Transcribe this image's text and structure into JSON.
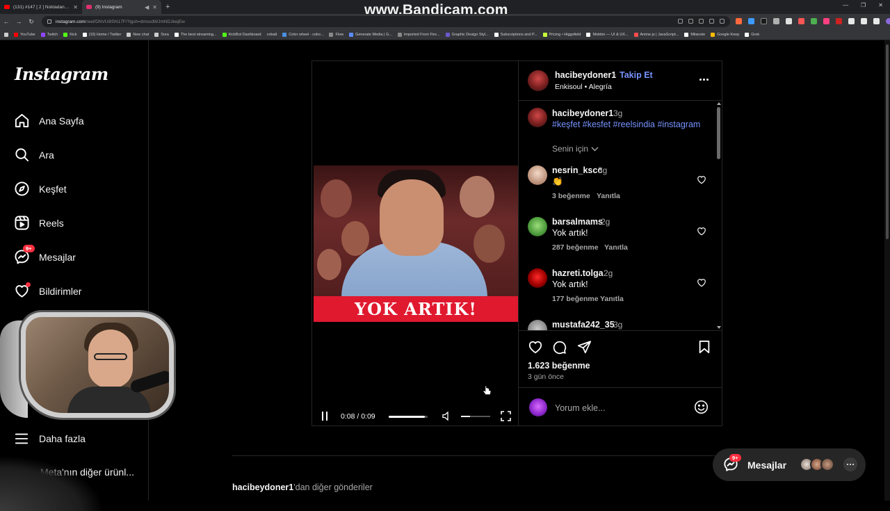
{
  "recording": {
    "watermark": "www.Bandicam.com"
  },
  "browser": {
    "tabs": [
      {
        "label": "(131) #147 [ 2 ] Noktadan Nokt",
        "fav_color": "#ff0000",
        "active": false
      },
      {
        "label": "(9) Instagram",
        "fav_color": "#e1306c",
        "active": true
      }
    ],
    "url": {
      "host": "instagram.com",
      "path": "/reel/DNVUi9SN17F/?igsh=dmsxdWJmNDJkejEw"
    },
    "bookmarks": [
      {
        "label": "YouTube",
        "color": "#ff0000"
      },
      {
        "label": "Twitch",
        "color": "#9146ff"
      },
      {
        "label": "Kick",
        "color": "#53fc18"
      },
      {
        "label": "(10) Home / Twitter",
        "color": "#ffffff"
      },
      {
        "label": "New chat",
        "color": "#cccccc"
      },
      {
        "label": "Sora",
        "color": "#cccccc"
      },
      {
        "label": "The best streaming...",
        "color": "#ffffff"
      },
      {
        "label": "KickBot Dashboard",
        "color": "#53fc18"
      },
      {
        "label": "cobalt",
        "color": "#dddddd"
      },
      {
        "label": "Color wheel - color...",
        "color": "#4a90e2"
      },
      {
        "label": "Flow",
        "color": "#888888"
      },
      {
        "label": "Generate Media | G...",
        "color": "#5b8cff"
      },
      {
        "label": "Imported From Fire...",
        "color": "#888888"
      },
      {
        "label": "Graphic Design Styl...",
        "color": "#6a5acd"
      },
      {
        "label": "Subscriptions and P...",
        "color": "#ffffff"
      },
      {
        "label": "Pricing • Higgsfield",
        "color": "#c6ff3c"
      },
      {
        "label": "Mobbin — UI & UX...",
        "color": "#ffffff"
      },
      {
        "label": "Anime.js | JavaScript...",
        "color": "#ff4b4b"
      },
      {
        "label": "Milanote",
        "color": "#ffffff"
      },
      {
        "label": "Google Keep",
        "color": "#fbbc04"
      },
      {
        "label": "Grok",
        "color": "#ffffff"
      }
    ]
  },
  "sidebar": {
    "logo": "Instagram",
    "items": [
      {
        "label": "Ana Sayfa",
        "icon": "home-icon"
      },
      {
        "label": "Ara",
        "icon": "search-icon"
      },
      {
        "label": "Keşfet",
        "icon": "compass-icon"
      },
      {
        "label": "Reels",
        "icon": "reels-icon"
      },
      {
        "label": "Mesajlar",
        "icon": "messenger-icon",
        "badge": "9+"
      },
      {
        "label": "Bildirimler",
        "icon": "heart-icon"
      }
    ],
    "more": "Daha fazla",
    "meta": "Meta'nın diğer ürünl..."
  },
  "post": {
    "video": {
      "caption_overlay": "YOK ARTIK!",
      "time": "0:08 / 0:09",
      "progress": 0.93,
      "volume": 0.3
    },
    "header": {
      "username": "hacibeydoner1",
      "separator": "•",
      "follow": "Takip Et",
      "music": "Enkisoul • Alegría"
    },
    "caption": {
      "username": "hacibeydoner1",
      "time": "3g",
      "tags": "#keşfet #kesfet #reelsindia #instagram"
    },
    "for_you": "Senin için",
    "comments": [
      {
        "username": "nesrin_kscc",
        "time": "3g",
        "text": "👏",
        "likes": "3 beğenme",
        "reply": "Yanıtla",
        "avatar": "av-nesrin"
      },
      {
        "username": "barsalmams",
        "time": "2g",
        "text": "Yok artık!",
        "likes": "287 beğenme",
        "reply": "Yanıtla",
        "avatar": "av-bars"
      },
      {
        "username": "hazreti.tolga",
        "time": "2g",
        "text": "Yok artık!",
        "likes": "177 beğenme",
        "reply": "Yanıtla",
        "avatar": "av-hazreti"
      },
      {
        "username": "mustafa242_35",
        "time": "3g",
        "text": "",
        "likes": "",
        "reply": "",
        "avatar": "av-mustafa"
      }
    ],
    "likes": "1.623 beğenme",
    "posted": "3 gün önce",
    "comment_placeholder": "Yorum ekle..."
  },
  "more_posts": {
    "username": "hacibeydoner1",
    "suffix": "'dan diğer gönderiler"
  },
  "messages_pill": {
    "label": "Mesajlar",
    "badge": "9+"
  },
  "colors": {
    "accent_link": "#7793ff",
    "badge": "#ff3040",
    "yok_bar": "#e0192f"
  }
}
